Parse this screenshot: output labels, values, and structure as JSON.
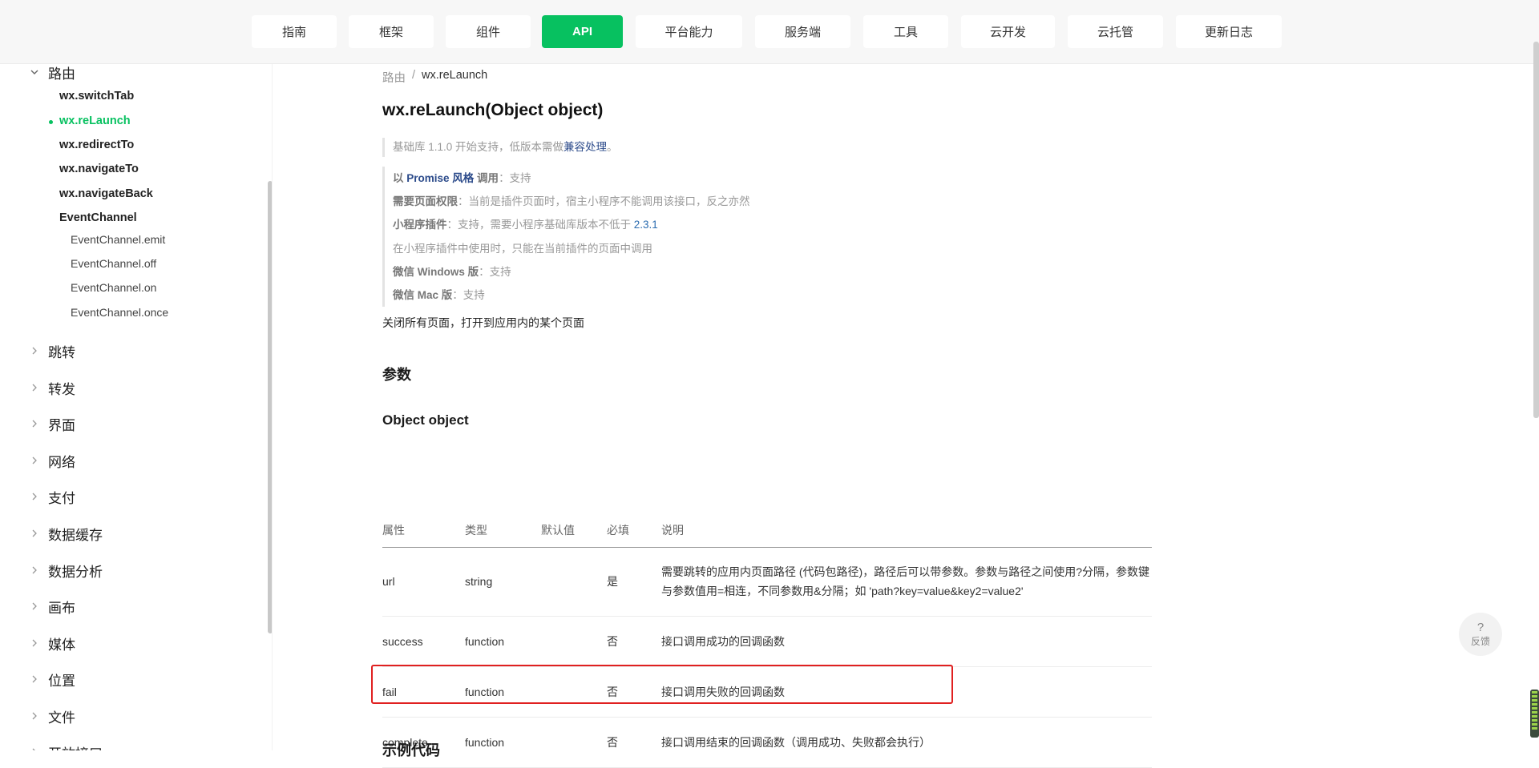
{
  "nav": {
    "tabs": [
      {
        "label": "指南"
      },
      {
        "label": "框架"
      },
      {
        "label": "组件"
      },
      {
        "label": "API"
      },
      {
        "label": "平台能力"
      },
      {
        "label": "服务端"
      },
      {
        "label": "工具"
      },
      {
        "label": "云开发"
      },
      {
        "label": "云托管"
      },
      {
        "label": "更新日志"
      }
    ]
  },
  "sidebar": {
    "open_group": "路由",
    "items": [
      "wx.switchTab",
      "wx.reLaunch",
      "wx.redirectTo",
      "wx.navigateTo",
      "wx.navigateBack",
      "EventChannel"
    ],
    "sub_items": [
      "EventChannel.emit",
      "EventChannel.off",
      "EventChannel.on",
      "EventChannel.once"
    ],
    "groups": [
      "跳转",
      "转发",
      "界面",
      "网络",
      "支付",
      "数据缓存",
      "数据分析",
      "画布",
      "媒体",
      "位置",
      "文件",
      "开放接口"
    ]
  },
  "breadcrumb": {
    "parent": "路由",
    "sep": "/",
    "current": "wx.reLaunch"
  },
  "page": {
    "title": "wx.reLaunch(Object object)",
    "since_prefix": "基础库 1.1.0 开始支持，低版本需做",
    "since_link": "兼容处理",
    "since_suffix": "。",
    "notes": {
      "promise_prefix": "以 ",
      "promise_link": "Promise 风格",
      "promise_label": " 调用",
      "promise_value": "：支持",
      "perm_label": "需要页面权限",
      "perm_value": "：当前是插件页面时，宿主小程序不能调用该接口，反之亦然",
      "plugin_label": "小程序插件",
      "plugin_value": "：支持，需要小程序基础库版本不低于 ",
      "plugin_version": "2.3.1",
      "plugin_note": "在小程序插件中使用时，只能在当前插件的页面中调用",
      "windows_label": "微信 Windows 版",
      "windows_value": "：支持",
      "mac_label": "微信 Mac 版",
      "mac_value": "：支持"
    },
    "description": "关闭所有页面，打开到应用内的某个页面",
    "params_heading": "参数",
    "object_heading": "Object object",
    "next_heading": "示例代码"
  },
  "table": {
    "headers": [
      "属性",
      "类型",
      "默认值",
      "必填",
      "说明"
    ],
    "rows": [
      {
        "prop": "url",
        "type": "string",
        "default": "",
        "required": "是",
        "desc": "需要跳转的应用内页面路径 (代码包路径)，路径后可以带参数。参数与路径之间使用?分隔，参数键与参数值用=相连，不同参数用&分隔；如 'path?key=value&key2=value2'"
      },
      {
        "prop": "success",
        "type": "function",
        "default": "",
        "required": "否",
        "desc": "接口调用成功的回调函数"
      },
      {
        "prop": "fail",
        "type": "function",
        "default": "",
        "required": "否",
        "desc": "接口调用失败的回调函数"
      },
      {
        "prop": "complete",
        "type": "function",
        "default": "",
        "required": "否",
        "desc": "接口调用结束的回调函数（调用成功、失败都会执行）"
      }
    ]
  },
  "feedback": {
    "symbol": "?",
    "label": "反馈"
  },
  "colors": {
    "accent": "#07c160",
    "highlight": "#e02020",
    "link": "#2b6cb0"
  }
}
